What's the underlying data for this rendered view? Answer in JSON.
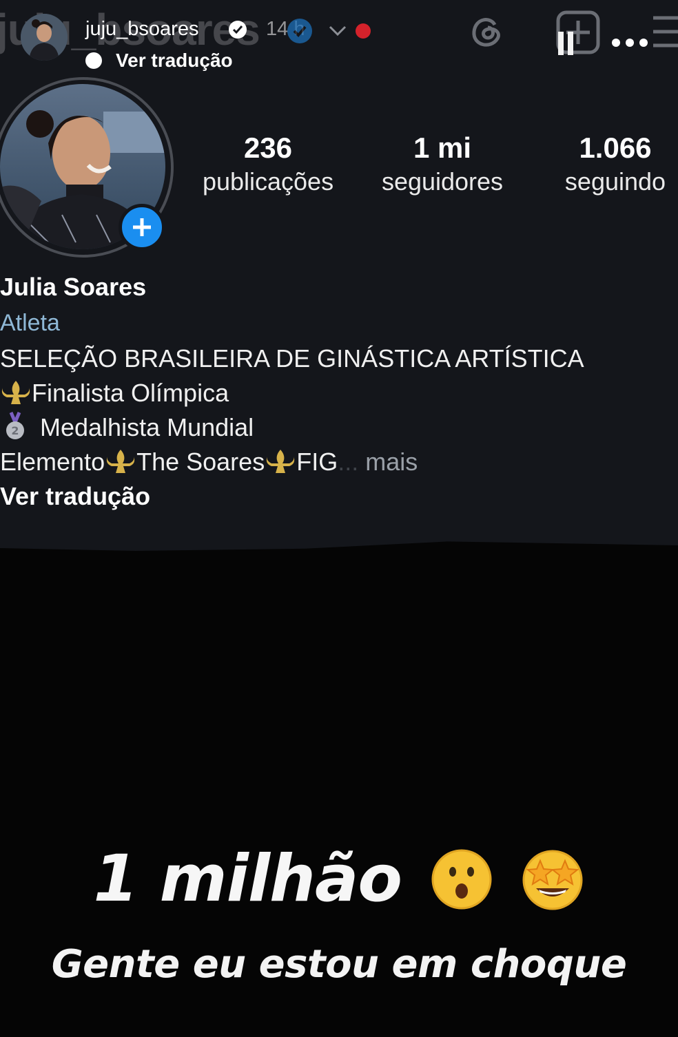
{
  "story_header": {
    "ghost_username": "juju_bsoares",
    "username": "juju_bsoares",
    "time": "14 h",
    "translate": "Ver tradução"
  },
  "icons": {
    "threads": "threads-icon",
    "add": "add-square-icon",
    "pause": "pause-icon",
    "more": "more-dots-icon",
    "menu": "menu-icon"
  },
  "colors": {
    "panel_bg": "#14161b",
    "story_bg": "#050505",
    "accent_blue": "#1a8ef0",
    "category": "#8fb8d6",
    "live_dot": "#d4222b"
  },
  "profile": {
    "stats": {
      "posts_count": "236",
      "posts_label": "publicações",
      "followers_count": "1 mi",
      "followers_label": "seguidores",
      "following_count": "1.066",
      "following_label": "seguindo"
    },
    "name": "Julia Soares",
    "category": "Atleta",
    "bio_line1": "SELEÇÃO BRASILEIRA DE GINÁSTICA ARTÍSTICA",
    "bio_line2": "Finalista Olímpica",
    "bio_line3": "Medalhista Mundial",
    "bio_line4_a": "Elemento",
    "bio_line4_b": "The Soares",
    "bio_line4_c": "FIG",
    "bio_ellipsis": "...",
    "bio_more": "mais",
    "translate": "Ver tradução"
  },
  "story_text": {
    "headline": "1 milhão",
    "subline": "Gente eu estou em choque"
  }
}
